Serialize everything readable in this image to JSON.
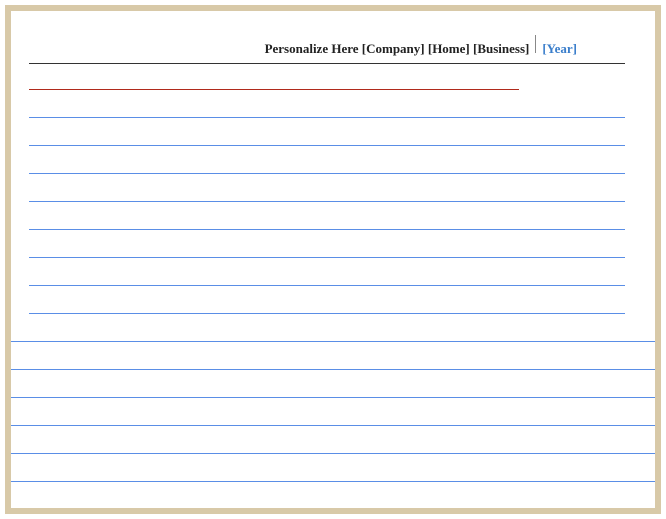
{
  "header": {
    "text": "Personalize Here [Company] [Home] [Business]",
    "year": "[Year]"
  },
  "colors": {
    "frame": "#d8c9a8",
    "rule_red": "#b02a1c",
    "rule_blue": "#5a8ee6",
    "year_blue": "#3a7ecb"
  },
  "lines": {
    "total_ruled": 15
  }
}
